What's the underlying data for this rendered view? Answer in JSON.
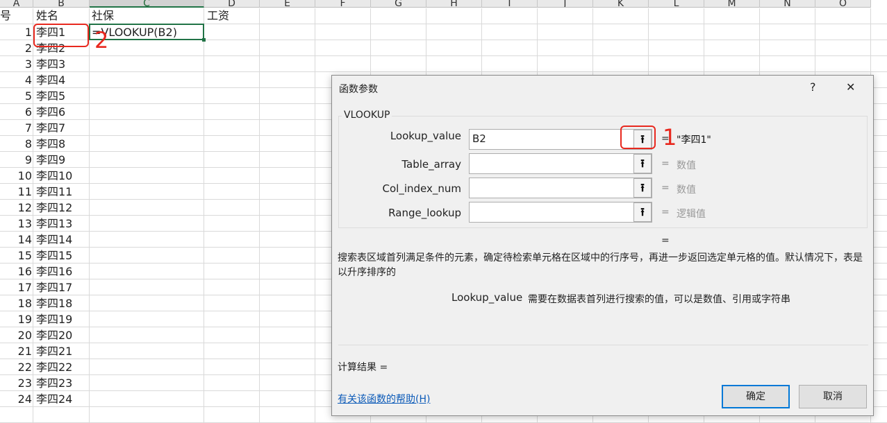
{
  "sheet": {
    "columns": [
      "A",
      "B",
      "C",
      "D",
      "E",
      "F",
      "G",
      "H",
      "I",
      "J",
      "K",
      "L",
      "M",
      "N",
      "O"
    ],
    "selected_column": "C",
    "header_row": {
      "a": "号",
      "b": "姓名",
      "c": "社保",
      "d": "工资"
    },
    "formula_cell": "=VLOOKUP(B2)",
    "rows": [
      {
        "n": "1",
        "name": "李四1"
      },
      {
        "n": "2",
        "name": "李四2"
      },
      {
        "n": "3",
        "name": "李四3"
      },
      {
        "n": "4",
        "name": "李四4"
      },
      {
        "n": "5",
        "name": "李四5"
      },
      {
        "n": "6",
        "name": "李四6"
      },
      {
        "n": "7",
        "name": "李四7"
      },
      {
        "n": "8",
        "name": "李四8"
      },
      {
        "n": "9",
        "name": "李四9"
      },
      {
        "n": "10",
        "name": "李四10"
      },
      {
        "n": "11",
        "name": "李四11"
      },
      {
        "n": "12",
        "name": "李四12"
      },
      {
        "n": "13",
        "name": "李四13"
      },
      {
        "n": "14",
        "name": "李四14"
      },
      {
        "n": "15",
        "name": "李四15"
      },
      {
        "n": "16",
        "name": "李四16"
      },
      {
        "n": "17",
        "name": "李四17"
      },
      {
        "n": "18",
        "name": "李四18"
      },
      {
        "n": "19",
        "name": "李四19"
      },
      {
        "n": "20",
        "name": "李四20"
      },
      {
        "n": "21",
        "name": "李四21"
      },
      {
        "n": "22",
        "name": "李四22"
      },
      {
        "n": "23",
        "name": "李四23"
      },
      {
        "n": "24",
        "name": "李四24"
      }
    ]
  },
  "annotations": {
    "marker_1": "1",
    "marker_2": "2",
    "color": "#e8281e"
  },
  "dialog": {
    "title": "函数参数",
    "help_glyph": "?",
    "close_glyph": "✕",
    "group_label": "VLOOKUP",
    "ref_icon": "collapse-dialog-icon",
    "params": [
      {
        "label": "Lookup_value",
        "value": "B2",
        "result": "\"李四1\""
      },
      {
        "label": "Table_array",
        "value": "",
        "result": "数值"
      },
      {
        "label": "Col_index_num",
        "value": "",
        "result": "数值"
      },
      {
        "label": "Range_lookup",
        "value": "",
        "result": "逻辑值"
      }
    ],
    "equals": "=",
    "description": "搜索表区域首列满足条件的元素，确定待检索单元格在区域中的行序号，再进一步返回选定单元格的值。默认情况下，表是以升序排序的",
    "arg_name": "Lookup_value",
    "arg_desc": "需要在数据表首列进行搜索的值，可以是数值、引用或字符串",
    "calc_result": "计算结果 =",
    "help_link": "有关该函数的帮助(H)",
    "ok": "确定",
    "cancel": "取消"
  }
}
